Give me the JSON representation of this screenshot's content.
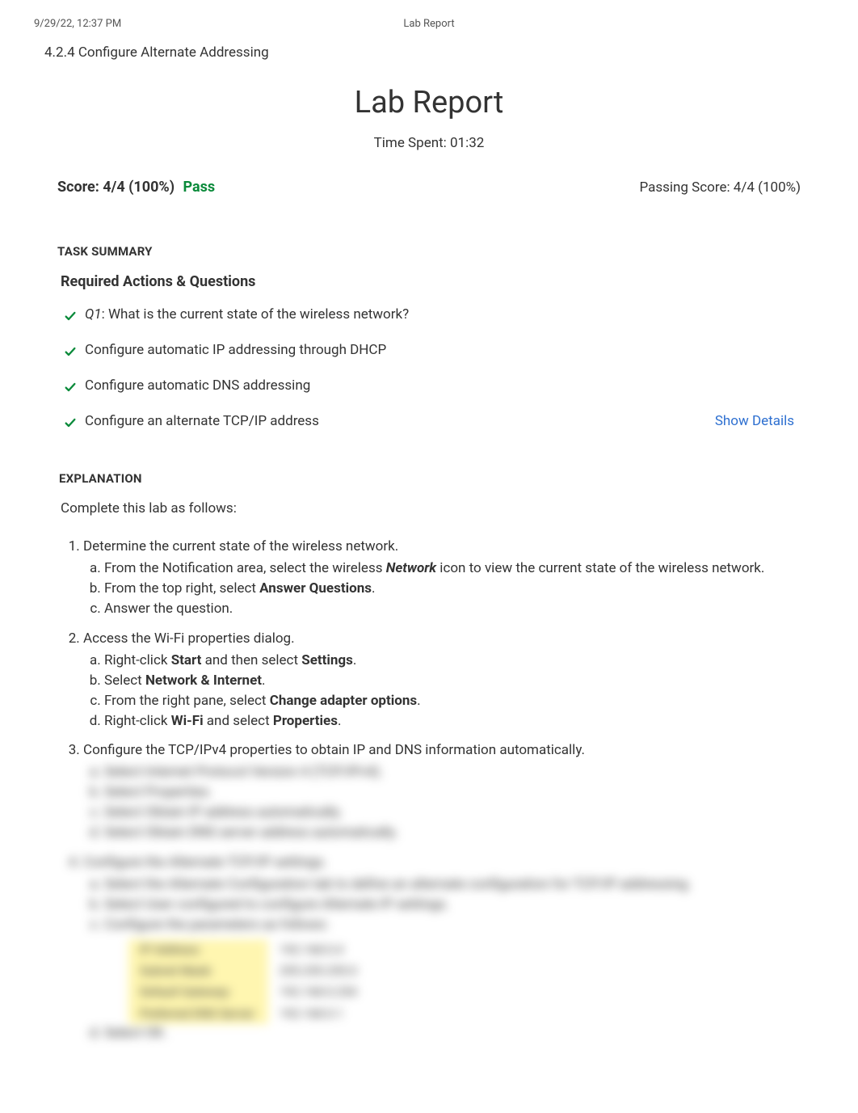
{
  "header": {
    "timestamp": "9/29/22, 12:37 PM",
    "doc_title": "Lab Report"
  },
  "breadcrumb": "4.2.4 Configure Alternate Addressing",
  "report": {
    "title": "Lab Report",
    "time_spent_label": "Time Spent: 01:32",
    "score_label": "Score: 4/4 (100%)",
    "pass_text": "Pass",
    "passing_score": "Passing Score: 4/4 (100%)"
  },
  "task_summary": {
    "heading": "TASK SUMMARY",
    "subheading": "Required Actions & Questions",
    "items": [
      {
        "prefix": "Q1",
        "sep": ":  ",
        "text": "What is the current state of the wireless network?",
        "show_details": false
      },
      {
        "prefix": "",
        "sep": "",
        "text": "Configure automatic IP addressing through DHCP",
        "show_details": false
      },
      {
        "prefix": "",
        "sep": "",
        "text": "Configure automatic DNS addressing",
        "show_details": false
      },
      {
        "prefix": "",
        "sep": "",
        "text": "Configure an alternate TCP/IP address",
        "show_details": true
      }
    ],
    "show_details_label": "Show Details"
  },
  "explanation": {
    "heading": "EXPLANATION",
    "intro": "Complete this lab as follows:",
    "steps": [
      {
        "text": "Determine the current state of the wireless network.",
        "sub": [
          {
            "pre": "From the Notification area, select the wireless ",
            "bold_italic": "Network",
            "post": " icon to view the current state of the wireless network."
          },
          {
            "pre": "From the top right, select ",
            "bold": "Answer Questions",
            "post": "."
          },
          {
            "pre": "Answer the question.",
            "bold": "",
            "post": ""
          }
        ]
      },
      {
        "text": "Access the Wi-Fi properties dialog.",
        "sub": [
          {
            "pre": "Right-click ",
            "bold": "Start",
            "post": " and then select ",
            "bold2": "Settings",
            "post2": "."
          },
          {
            "pre": "Select ",
            "bold": "Network & Internet",
            "post": "."
          },
          {
            "pre": "From the right pane, select ",
            "bold": "Change adapter options",
            "post": "."
          },
          {
            "pre": "Right-click ",
            "bold": "Wi-Fi",
            "post": " and select ",
            "bold2": "Properties",
            "post2": "."
          }
        ]
      },
      {
        "text": "Configure the TCP/IPv4 properties to obtain IP and DNS information automatically.",
        "sub_blurred": [
          "Select Internet Protocol Version 4 (TCP/IPv4).",
          "Select Properties.",
          "Select Obtain IP address automatically.",
          "Select Obtain DNS server address automatically."
        ]
      }
    ],
    "step4_blurred": {
      "head": "Configure the Alternate TCP/IP settings.",
      "subs": [
        "Select the Alternate Configuration tab to define an alternate configuration for TCP/IP addressing.",
        "Select User configured to configure Alternate IP settings.",
        "Configure the parameters as follows:"
      ],
      "table": [
        [
          "IP Address:",
          "192.168.0.4"
        ],
        [
          "Subnet Mask:",
          "255.255.255.0"
        ],
        [
          "Default Gateway:",
          "192.168.0.254"
        ],
        [
          "Preferred DNS Server:",
          "192.168.0.1"
        ]
      ],
      "tail": "Select OK."
    }
  }
}
